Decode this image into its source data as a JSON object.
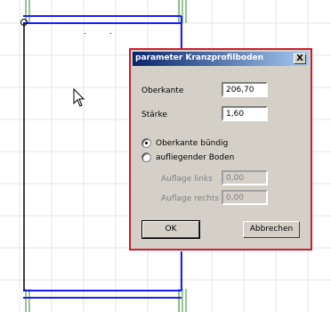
{
  "dialog": {
    "title": "parameter Kranzprofilboden",
    "close_glyph": "X",
    "oberkante": {
      "label": "Oberkante",
      "value": "206,70"
    },
    "staerke": {
      "label": "Stärke",
      "value": "1,60"
    },
    "radio_options": [
      {
        "label": "Oberkante bündig",
        "selected": true
      },
      {
        "label": "aufliegender Boden",
        "selected": false
      }
    ],
    "auflage_links": {
      "label": "Auflage links",
      "value": "0,00"
    },
    "auflage_rechts": {
      "label": "Auflage rechts",
      "value": "0,00"
    },
    "ok_label": "OK",
    "cancel_label": "Abbrechen"
  },
  "colors": {
    "cad_outline": "#1a1aff",
    "cad_frame": "#2e8b2e",
    "grid": "#e6e6e6",
    "dialog_border": "#cc1f2e"
  },
  "icons": {
    "cursor": "arrow-cursor-icon"
  }
}
